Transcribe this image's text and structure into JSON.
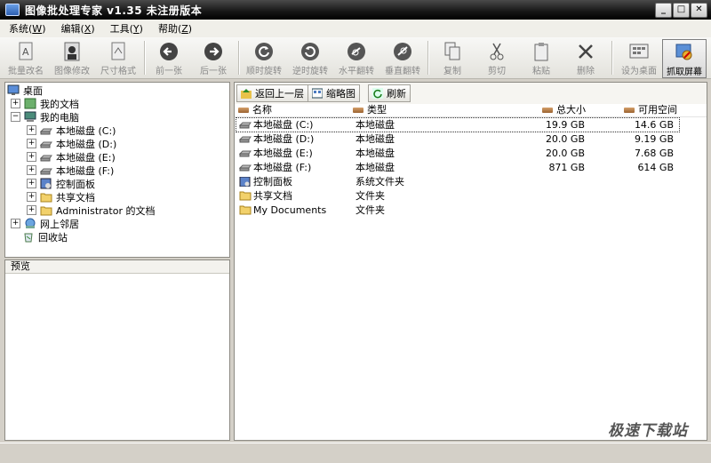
{
  "window": {
    "title": "图像批处理专家 v1.35 未注册版本",
    "min": "_",
    "max": "□",
    "close": "✕"
  },
  "menu": [
    {
      "label": "系统(",
      "key": "W",
      "end": ")"
    },
    {
      "label": "编辑(",
      "key": "X",
      "end": ")"
    },
    {
      "label": "工具(",
      "key": "Y",
      "end": ")"
    },
    {
      "label": "帮助(",
      "key": "Z",
      "end": ")"
    }
  ],
  "toolbar": {
    "rename": "批量改名",
    "edit": "图像修改",
    "resize": "尺寸格式",
    "prev": "前一张",
    "next": "后一张",
    "rot_cw": "顺时旋转",
    "rot_ccw": "逆时旋转",
    "flip_h": "水平翻转",
    "flip_v": "垂直翻转",
    "copy": "复制",
    "cut": "剪切",
    "paste": "粘贴",
    "delete": "删除",
    "wallpaper": "设为桌面",
    "capture": "抓取屏幕"
  },
  "tree": {
    "desktop": "桌面",
    "my_docs": "我的文档",
    "my_computer": "我的电脑",
    "drives": [
      "本地磁盘 (C:)",
      "本地磁盘 (D:)",
      "本地磁盘 (E:)",
      "本地磁盘 (F:)"
    ],
    "control_panel": "控制面板",
    "shared": "共享文档",
    "admin_docs": "Administrator 的文档",
    "network": "网上邻居",
    "recycle": "回收站"
  },
  "preview": {
    "title": "预览"
  },
  "browser": {
    "back": "返回上一层",
    "thumbs": "缩略图",
    "refresh": "刷新",
    "columns": {
      "name": "名称",
      "type": "类型",
      "total": "总大小",
      "free": "可用空间"
    },
    "rows": [
      {
        "name": "本地磁盘 (C:)",
        "type": "本地磁盘",
        "total": "19.9 GB",
        "free": "14.6 GB"
      },
      {
        "name": "本地磁盘 (D:)",
        "type": "本地磁盘",
        "total": "20.0 GB",
        "free": "9.19 GB"
      },
      {
        "name": "本地磁盘 (E:)",
        "type": "本地磁盘",
        "total": "20.0 GB",
        "free": "7.68 GB"
      },
      {
        "name": "本地磁盘 (F:)",
        "type": "本地磁盘",
        "total": "871 GB",
        "free": "614 GB"
      },
      {
        "name": "控制面板",
        "type": "系统文件夹",
        "total": "",
        "free": ""
      },
      {
        "name": "共享文档",
        "type": "文件夹",
        "total": "",
        "free": ""
      },
      {
        "name": "My Documents",
        "type": "文件夹",
        "total": "",
        "free": ""
      }
    ]
  },
  "watermark": "极速下载站"
}
